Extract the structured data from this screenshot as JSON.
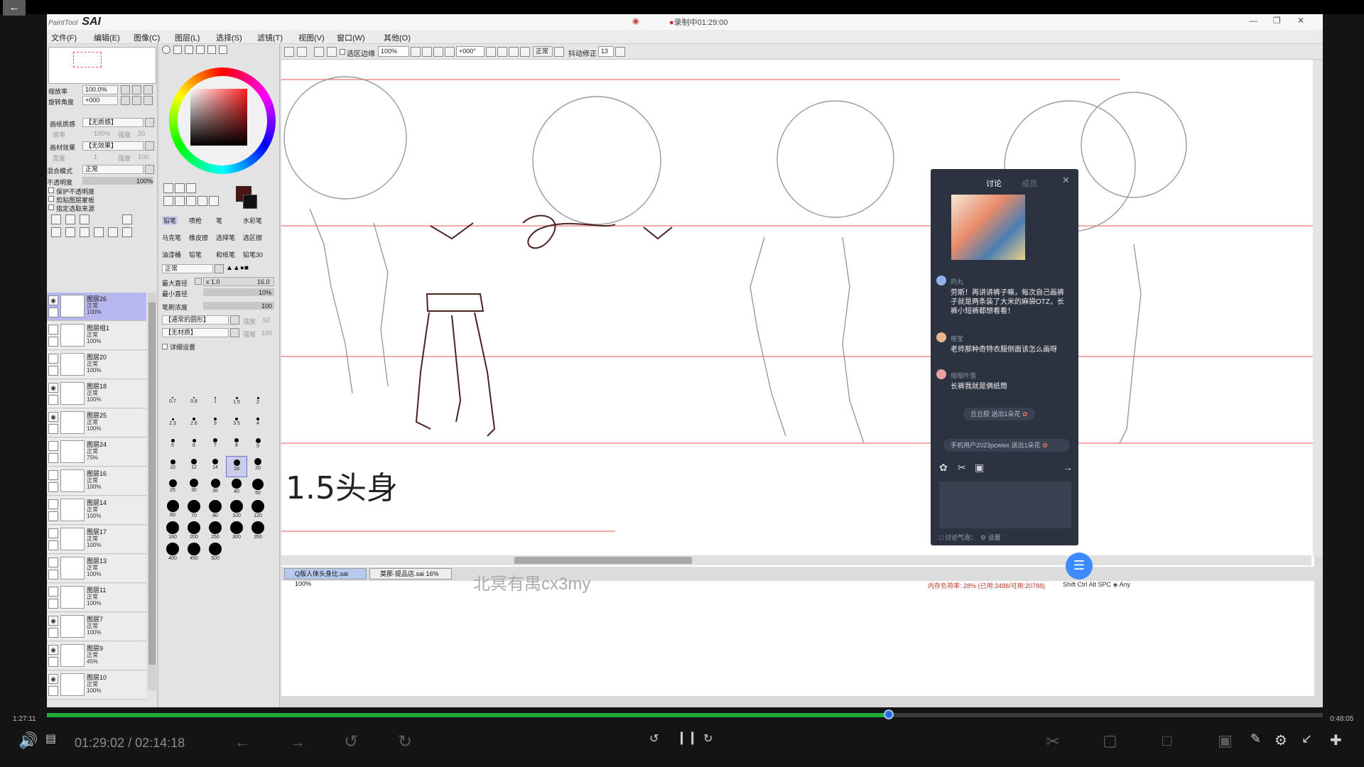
{
  "player": {
    "back_icon": "arrow-left-icon",
    "current_time": "01:29:02",
    "separator": "/",
    "total_time": "02:14:18",
    "bar_left_time": "1:27:11",
    "bar_right_time": "0:48:05",
    "progress_fraction": 0.66,
    "buffer_fraction": 0.66,
    "accent": "#1fae3a",
    "knob_color": "#2a6bd8"
  },
  "recording": {
    "label": "录制中01:29:00"
  },
  "sai": {
    "logo_small": "PaintTool",
    "logo_big": "SAI",
    "menu": [
      "文件(F)",
      "编辑(E)",
      "图像(C)",
      "图层(L)",
      "选择(S)",
      "滤镜(T)",
      "视图(V)",
      "窗口(W)",
      "其他(O)"
    ],
    "left": {
      "zoom_label": "缩放率",
      "zoom_value": "100.0%",
      "angle_label": "旋转角度",
      "angle_value": "+000",
      "paper_label": "画纸质感",
      "paper_value": "【无质感】",
      "paper_sub1": "倍率",
      "paper_sub2": "100%",
      "paper_sub3": "强度",
      "paper_sub4": "20",
      "effect_label": "画材效果",
      "effect_value": "【无效果】",
      "effect_sub1": "宽度",
      "effect_sub2": "1",
      "effect_sub3": "强度",
      "effect_sub4": "100",
      "blend_label": "混合模式",
      "blend_value": "正常",
      "opacity_label": "不透明度",
      "opacity_value": "100%",
      "check1": "保护不透明度",
      "check2": "剪贴图层蒙板",
      "check3": "指定选取来源"
    },
    "layers": [
      {
        "name": "图层26",
        "mode": "正常",
        "opacity": "100%",
        "visible": true,
        "active": true
      },
      {
        "name": "图层组1",
        "mode": "正常",
        "opacity": "100%",
        "visible": false,
        "active": false
      },
      {
        "name": "图层20",
        "mode": "正常",
        "opacity": "100%",
        "visible": false,
        "active": false
      },
      {
        "name": "图层18",
        "mode": "正常",
        "opacity": "100%",
        "visible": true,
        "active": false
      },
      {
        "name": "图层25",
        "mode": "正常",
        "opacity": "100%",
        "visible": true,
        "active": false
      },
      {
        "name": "图层24",
        "mode": "正常",
        "opacity": "75%",
        "visible": false,
        "active": false
      },
      {
        "name": "图层16",
        "mode": "正常",
        "opacity": "100%",
        "visible": false,
        "active": false
      },
      {
        "name": "图层14",
        "mode": "正常",
        "opacity": "100%",
        "visible": false,
        "active": false
      },
      {
        "name": "图层17",
        "mode": "正常",
        "opacity": "100%",
        "visible": false,
        "active": false
      },
      {
        "name": "图层13",
        "mode": "正常",
        "opacity": "100%",
        "visible": false,
        "active": false
      },
      {
        "name": "图层11",
        "mode": "正常",
        "opacity": "100%",
        "visible": false,
        "active": false
      },
      {
        "name": "图层7",
        "mode": "正常",
        "opacity": "100%",
        "visible": true,
        "active": false
      },
      {
        "name": "图层9",
        "mode": "正常",
        "opacity": "45%",
        "visible": true,
        "active": false
      },
      {
        "name": "图层10",
        "mode": "正常",
        "opacity": "100%",
        "visible": true,
        "active": false
      }
    ],
    "tools": {
      "tabs_row1": [
        "铅笔",
        "喷枪",
        "笔",
        "水彩笔"
      ],
      "tabs_row2": [
        "马克笔",
        "橡皮擦",
        "选择笔",
        "选区擦"
      ],
      "tabs_row3": [
        "油漆桶",
        "铅笔",
        "和纸笔",
        "铅笔30"
      ],
      "mode_value": "正常",
      "max_size_label": "最大直径",
      "max_size_mult": "x 1.0",
      "max_size_value": "16.0",
      "min_size_label": "最小直径",
      "min_size_value": "10%",
      "density_label": "笔刷浓度",
      "density_value": "100",
      "shape_value": "【通常的圆形】",
      "shape_side": "强度",
      "shape_side_val": "50",
      "texture_value": "【无材质】",
      "texture_side": "强度",
      "texture_side_val": "100",
      "detail_label": "详细设置",
      "sizes": [
        "0.7",
        "0.8",
        "1",
        "1.5",
        "2",
        "2.3",
        "2.6",
        "3",
        "3.5",
        "4",
        "5",
        "6",
        "7",
        "8",
        "9",
        "10",
        "12",
        "14",
        "16",
        "20",
        "25",
        "30",
        "35",
        "40",
        "50",
        "60",
        "70",
        "80",
        "100",
        "120",
        "160",
        "200",
        "250",
        "300",
        "350",
        "400",
        "450",
        "500"
      ],
      "selected_size": "16"
    },
    "toolbar": {
      "select_edge": "选区边缘",
      "zoom": "100%",
      "angle": "+000°",
      "mode": "正常",
      "stabilizer_label": "抖动修正",
      "stabilizer_value": "13"
    },
    "canvas_text": {
      "label_15": "1.5头身"
    },
    "file_tabs": [
      {
        "name": "Q版人体头身比.sai",
        "zoom": "100%"
      },
      {
        "name": "莫那·提品店.sai",
        "zoom": "16%"
      }
    ],
    "status": "内存负荷率: 28% (已用:3488/可用:20788)",
    "status_keys": "Shift Ctrl Alt SPC ◈ Any",
    "watermark": "北冥有禺cx3my"
  },
  "discussion": {
    "tab_active": "讨论",
    "tab_other": "成员",
    "close_icon": "close-icon",
    "messages": [
      {
        "user": "药丸",
        "text": "劳斯！再讲讲裤子嘛，每次自己画裤子就是两条装了大米的麻袋OTZ，长裤小短裤都想看看！"
      },
      {
        "user": "格宝",
        "text": "老师那种奇特衣服侧面该怎么画呀"
      },
      {
        "user": "缩缩叶落",
        "text": "长裤我就是俩纸筒"
      }
    ],
    "gifts": [
      {
        "text": "丘丘胶 送出1朵花"
      },
      {
        "text": "手机用户2023pcwwx 送出1朵花"
      }
    ],
    "footer_status": "讨论气泡：",
    "footer_settings": "设置"
  }
}
